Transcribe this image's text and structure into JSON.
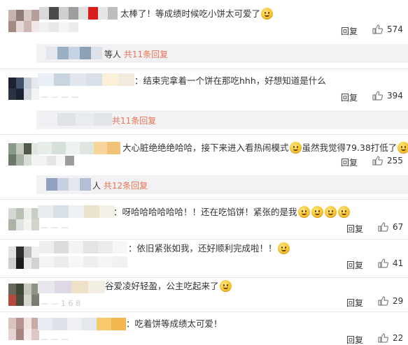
{
  "comments": [
    {
      "text_pre": "太棒了！等成绩时候吃小饼太可爱了",
      "text_post": "",
      "emojis": 1,
      "reply": "回复",
      "likes": "574"
    },
    {
      "text_pre": "：结束完拿着一个饼在那吃hhh，好想知道是什么",
      "text_post": "",
      "emojis": 0,
      "reply": "回复",
      "likes": "394"
    },
    {
      "text_pre": "大心脏绝绝绝哈哈，接下来进入看热闹模式",
      "text_mid": "虽然我觉得79.38打低了",
      "text_post": "",
      "emojis": 2,
      "reply": "回复",
      "likes": "255"
    },
    {
      "text_pre": "：呀哈哈哈哈哈哈！！还在吃馅饼！紧张的是我",
      "text_post": "",
      "emojis": 4,
      "reply": "回复",
      "likes": "67"
    },
    {
      "text_pre": "：依旧紧张如我，还好顺利完成啦！！",
      "text_post": "",
      "emojis": 1,
      "reply": "回复",
      "likes": "41"
    },
    {
      "text_pre": "谷爱凌好轻盈，公主吃起来了",
      "text_post": "",
      "emojis": 1,
      "reply": "回复",
      "likes": "29"
    },
    {
      "text_pre": "：吃着饼等成绩太可爱！",
      "text_post": "",
      "emojis": 0,
      "reply": "回复",
      "likes": "22"
    }
  ],
  "sub_replies": [
    {
      "prefix": "等人",
      "link": "共11条回复"
    },
    {
      "prefix": "",
      "link": "共11条回复"
    },
    {
      "prefix": "人",
      "link": "共12条回复"
    }
  ],
  "colors": {
    "link": "#eb7350",
    "text": "#333333",
    "sub_bg": "#f2f2f5",
    "like_icon": "#808080"
  },
  "icons": {
    "like": "thumbs-up-icon",
    "emoji": "smiley-emoji-icon"
  }
}
